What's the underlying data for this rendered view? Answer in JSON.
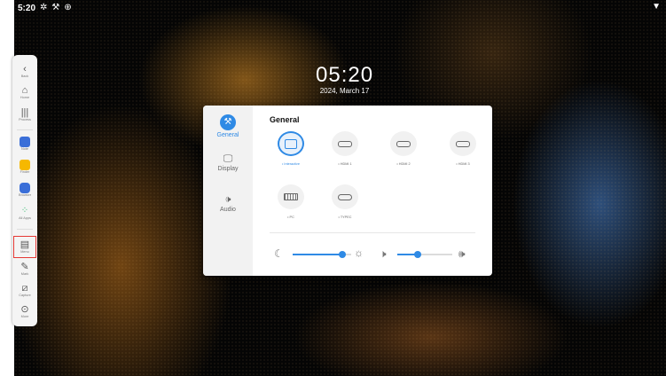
{
  "status_bar": {
    "time": "5:20",
    "icons": [
      "gear-icon",
      "wrench-icon",
      "globe-icon",
      "wifi-icon"
    ]
  },
  "clock": {
    "time": "05:20",
    "date": "2024, March 17"
  },
  "toolbar": {
    "items": [
      {
        "label": "Back",
        "icon": "chevron-left-icon"
      },
      {
        "label": "Home",
        "icon": "home-icon"
      },
      {
        "label": "Process",
        "icon": "process-icon"
      },
      {
        "label": "Note",
        "icon": "note-app-icon",
        "color": "#3b6fd8"
      },
      {
        "label": "Finder",
        "icon": "folder-app-icon",
        "color": "#f6b800"
      },
      {
        "label": "Browser",
        "icon": "browser-app-icon",
        "color": "#3b6fd8"
      },
      {
        "label": "All Apps",
        "icon": "all-apps-icon",
        "color": "#2fb86b"
      },
      {
        "label": "Menu",
        "icon": "menu-icon",
        "highlighted": true
      },
      {
        "label": "Mark",
        "icon": "pen-icon"
      },
      {
        "label": "Capture",
        "icon": "capture-icon"
      },
      {
        "label": "More",
        "icon": "more-icon"
      }
    ]
  },
  "settings": {
    "title": "General",
    "tabs": [
      {
        "label": "General",
        "icon": "wrench-icon",
        "active": true
      },
      {
        "label": "Display",
        "icon": "monitor-icon",
        "active": false
      },
      {
        "label": "Audio",
        "icon": "speaker-icon",
        "active": false
      }
    ],
    "sources": [
      {
        "label": "• Interactive",
        "icon": "screen-icon",
        "selected": true
      },
      {
        "label": "• HDMI 1",
        "icon": "hdmi-port-icon",
        "selected": false
      },
      {
        "label": "• HDMI 2",
        "icon": "hdmi-port-icon",
        "selected": false
      },
      {
        "label": "• HDMI 3",
        "icon": "hdmi-port-icon",
        "selected": false
      },
      {
        "label": "• PC",
        "icon": "vga-port-icon",
        "selected": false
      },
      {
        "label": "• TYPEC",
        "icon": "typec-port-icon",
        "selected": false
      }
    ],
    "brightness": {
      "value": 0.85,
      "low_icon": "moon-icon",
      "high_icon": "sun-icon"
    },
    "volume": {
      "value": 0.37,
      "low_icon": "mute-icon",
      "high_icon": "volume-icon"
    },
    "accent": "#2f8ae5"
  }
}
